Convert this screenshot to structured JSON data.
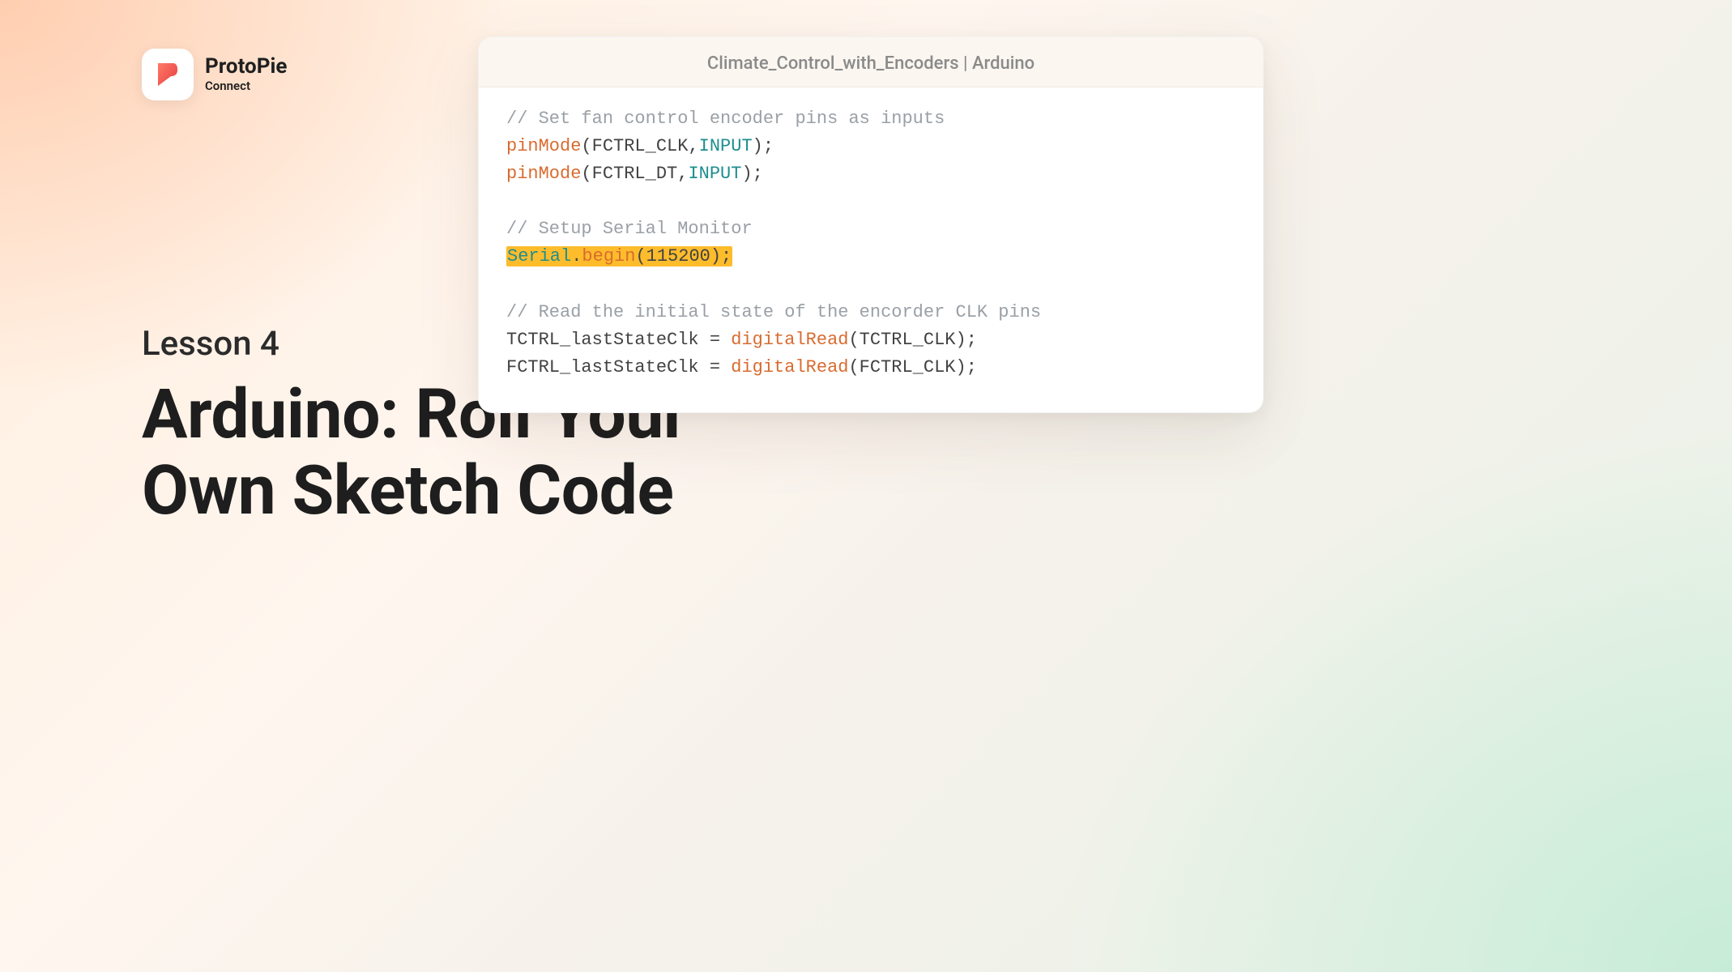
{
  "brand": {
    "product": "ProtoPie",
    "sub": "Connect"
  },
  "lesson_label": "Lesson 4",
  "title_line1": "Arduino: Roll Your",
  "title_line2": "Own Sketch Code",
  "window": {
    "title": "Climate_Control_with_Encoders | Arduino"
  },
  "code": {
    "c1": "// Set fan control encoder pins as inputs",
    "l2_func": "pinMode",
    "l2_open": "(FCTRL_CLK,",
    "l2_kw": "INPUT",
    "l2_close": ");",
    "l3_func": "pinMode",
    "l3_open": "(FCTRL_DT,",
    "l3_kw": "INPUT",
    "l3_close": ");",
    "c2": "// Setup Serial Monitor",
    "hl_obj": "Serial",
    "hl_dot": ".",
    "hl_method": "begin",
    "hl_open": "(",
    "hl_num": "115200",
    "hl_close": ");",
    "c3": "// Read the initial state of the encorder CLK pins",
    "l8_lhs": "TCTRL_lastStateClk = ",
    "l8_func": "digitalRead",
    "l8_args": "(TCTRL_CLK);",
    "l9_lhs": "FCTRL_lastStateClk = ",
    "l9_func": "digitalRead",
    "l9_args": "(FCTRL_CLK);"
  }
}
